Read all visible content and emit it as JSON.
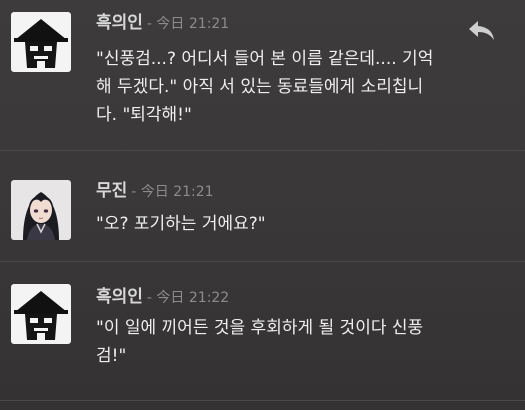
{
  "messages": [
    {
      "author": "흑의인",
      "timestamp": "- 今日 21:21",
      "text": "\"신풍검...? 어디서 들어 본 이름 같은데.... 기억\n해 두겠다.\" 아직 서 있는 동료들에게 소리칩니\n다. \"퇴각해!\"",
      "avatar_icon": "straw-hat-avatar-icon"
    },
    {
      "author": "무진",
      "timestamp": "- 今日 21:21",
      "text": "\"오? 포기하는 거에요?\"",
      "avatar_icon": "anime-character-avatar-icon"
    },
    {
      "author": "흑의인",
      "timestamp": "- 今日 21:22",
      "text": "\"이 일에 끼어든 것을 후회하게 될 것이다 신풍\n검!\"",
      "avatar_icon": "straw-hat-avatar-icon"
    }
  ],
  "actions": {
    "reply_icon": "reply-icon"
  },
  "colors": {
    "background": "#3a3838",
    "author": "#d8d8d8",
    "timestamp": "#8c8c8c",
    "text": "#efefef",
    "divider": "#4a4848"
  }
}
